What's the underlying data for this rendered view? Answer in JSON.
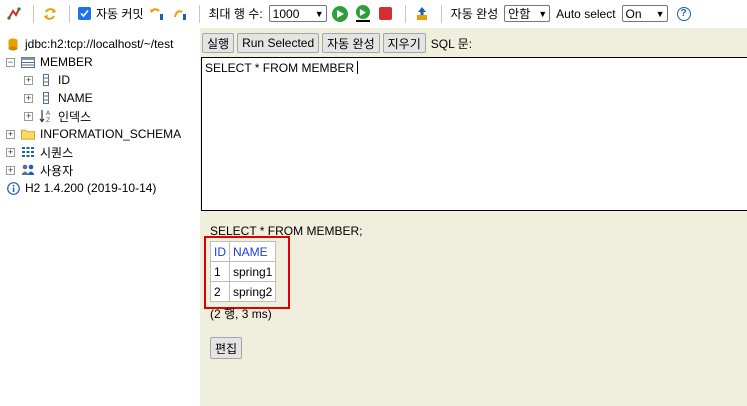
{
  "toolbar": {
    "autocommit_label": "자동 커밋",
    "max_rows_label": "최대 행 수:",
    "max_rows_value": "1000",
    "autocomplete_label": "자동 완성",
    "autocomplete_value": "안함",
    "autoselect_label": "Auto select",
    "autoselect_value": "On",
    "help_glyph": "?"
  },
  "tree": {
    "connection": "jdbc:h2:tcp://localhost/~/test",
    "table": "MEMBER",
    "columns": [
      "ID",
      "NAME"
    ],
    "indexes": "인덱스",
    "info_schema": "INFORMATION_SCHEMA",
    "sequences": "시퀀스",
    "users": "사용자",
    "version": "H2 1.4.200 (2019-10-14)"
  },
  "buttons": {
    "run": "실행",
    "run_selected": "Run Selected",
    "autocomplete": "자동 완성",
    "clear": "지우기",
    "sql_label": "SQL 문:"
  },
  "editor": {
    "text": "SELECT * FROM MEMBER"
  },
  "result": {
    "sql": "SELECT * FROM MEMBER;",
    "headers": [
      "ID",
      "NAME"
    ],
    "rows": [
      [
        "1",
        "spring1"
      ],
      [
        "2",
        "spring2"
      ]
    ],
    "status": "(2 행, 3 ms)",
    "edit_button": "편집"
  },
  "colors": {
    "highlight": "#e00000",
    "panel": "#f0eedc",
    "header_text": "#1b3fd6"
  }
}
